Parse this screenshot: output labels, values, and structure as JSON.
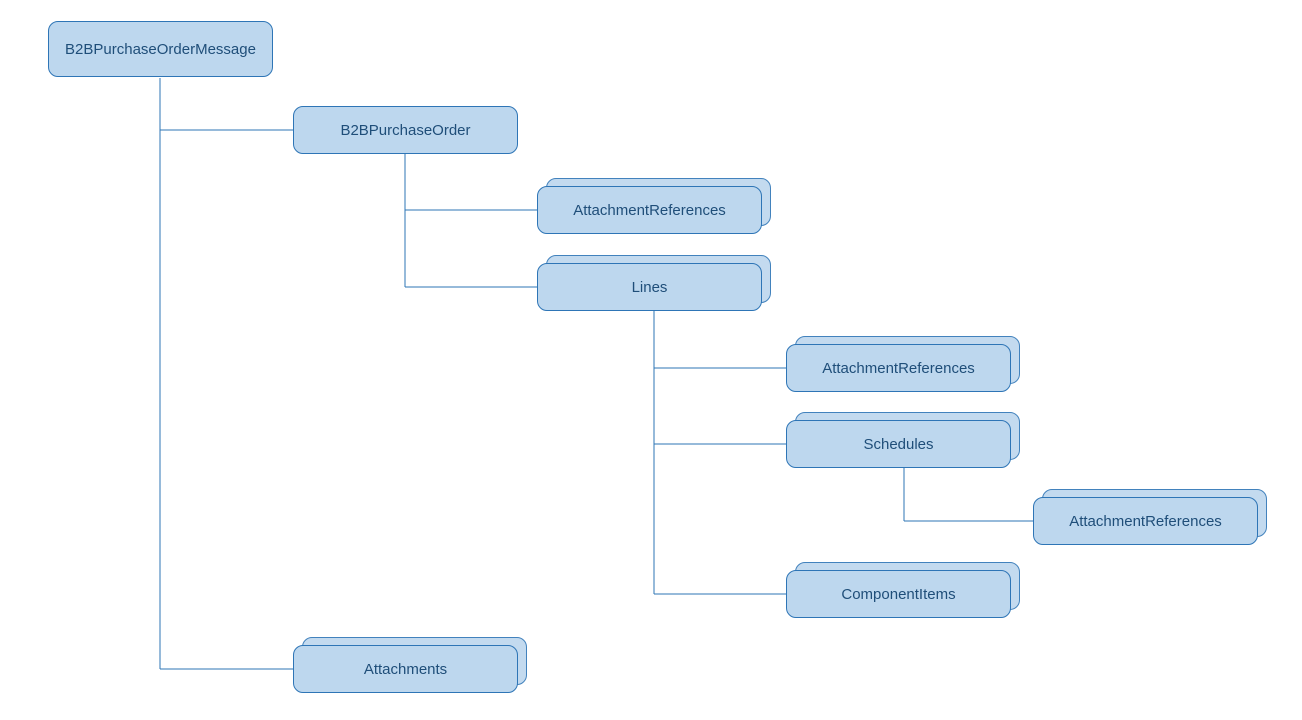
{
  "diagram": {
    "root": "B2BPurchaseOrderMessage",
    "nodes": {
      "n1": "B2BPurchaseOrder",
      "n2": "AttachmentReferences",
      "n3": "Lines",
      "n4": "AttachmentReferences",
      "n5": "Schedules",
      "n6": "AttachmentReferences",
      "n7": "ComponentItems",
      "n8": "Attachments"
    }
  }
}
